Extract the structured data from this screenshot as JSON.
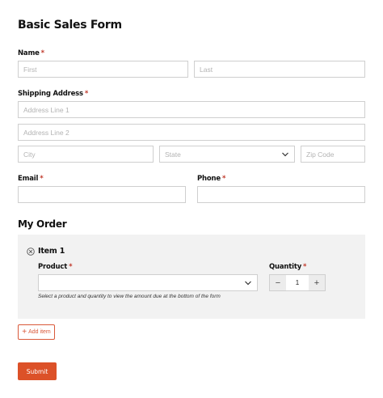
{
  "form": {
    "title": "Basic Sales Form"
  },
  "name": {
    "label": "Name",
    "required_mark": "*",
    "first_placeholder": "First",
    "last_placeholder": "Last"
  },
  "shipping": {
    "label": "Shipping Address",
    "required_mark": "*",
    "line1_placeholder": "Address Line 1",
    "line2_placeholder": "Address Line 2",
    "city_placeholder": "City",
    "state_placeholder": "State",
    "zip_placeholder": "Zip Code"
  },
  "email": {
    "label": "Email",
    "required_mark": "*"
  },
  "phone": {
    "label": "Phone",
    "required_mark": "*"
  },
  "order": {
    "section_title": "My Order",
    "item": {
      "title": "Item 1",
      "product_label": "Product",
      "product_required_mark": "*",
      "product_selected": "",
      "quantity_label": "Quantity",
      "quantity_required_mark": "*",
      "quantity_value": "1",
      "decrement": "−",
      "increment": "+",
      "helper_text": "Select a product and quantity to view the amount due at the bottom of the form"
    },
    "add_item_plus": "+",
    "add_item_label": "Add item"
  },
  "submit_label": "Submit",
  "colors": {
    "accent": "#dc5128",
    "panel_bg": "#f2f2f2",
    "border": "#cfcfcf",
    "required": "#c0392b"
  }
}
